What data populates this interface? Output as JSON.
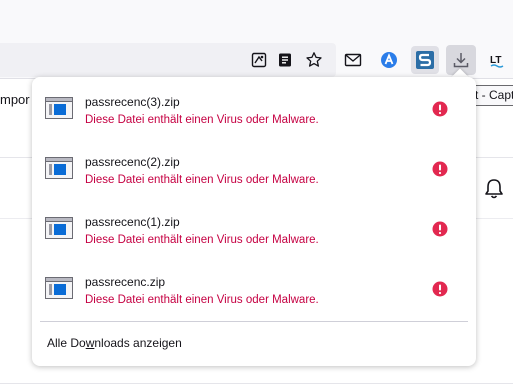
{
  "page": {
    "partial_text": "mpor"
  },
  "tooltip": {
    "text": "FireShot - Capt"
  },
  "colors": {
    "danger": "#c50042",
    "warning_icon": "#e22850",
    "accent_blue": "#0a84ff"
  },
  "downloads": {
    "items": [
      {
        "filename": "passrecenc(3).zip",
        "status": "Diese Datei enthält einen Virus oder Malware."
      },
      {
        "filename": "passrecenc(2).zip",
        "status": "Diese Datei enthält einen Virus oder Malware."
      },
      {
        "filename": "passrecenc(1).zip",
        "status": "Diese Datei enthält einen Virus oder Malware."
      },
      {
        "filename": "passrecenc.zip",
        "status": "Diese Datei enthält einen Virus oder Malware."
      }
    ],
    "show_all_pre": "Alle Do",
    "show_all_mnemonic": "w",
    "show_all_post": "nloads anzeigen"
  }
}
